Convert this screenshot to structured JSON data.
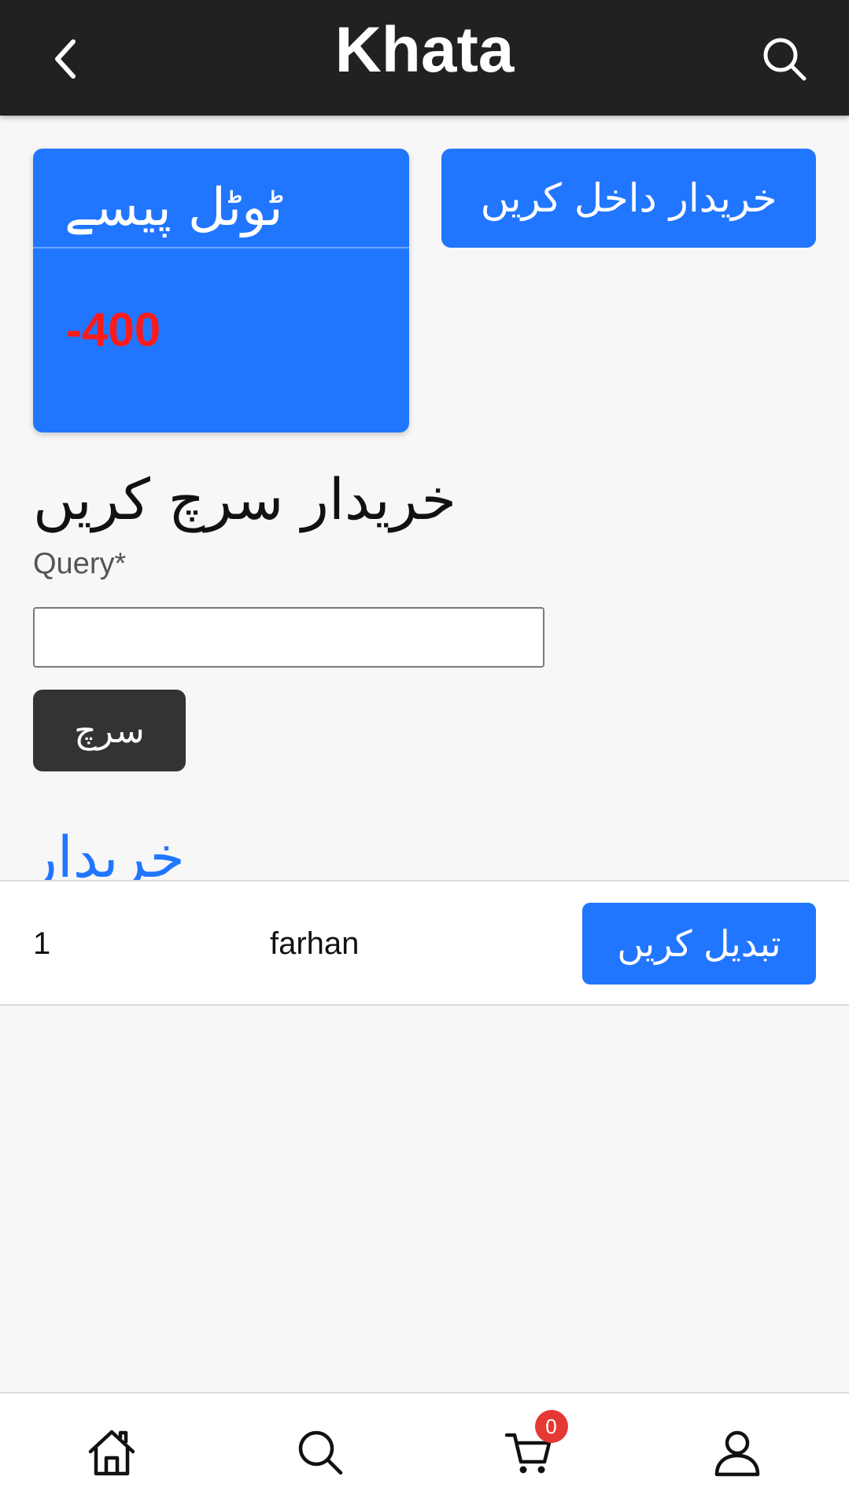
{
  "header": {
    "title": "Khata",
    "back_icon": "chevron-left-icon",
    "search_icon": "search-icon"
  },
  "total_card": {
    "title": "ٹوٹل پیسے",
    "value": "-400",
    "value_color": "#ff1a1a"
  },
  "actions": {
    "add_customer_label": "خریدار داخل کریں"
  },
  "search": {
    "heading": "خریدار سرچ کریں",
    "query_label": "Query*",
    "query_value": "",
    "button_label": "سرچ"
  },
  "customers": {
    "heading": "خریدار",
    "rows": [
      {
        "id": "1",
        "name": "farhan",
        "edit_label": "تبدیل کریں"
      }
    ]
  },
  "bottom_nav": {
    "items": [
      {
        "icon": "home-icon"
      },
      {
        "icon": "search-icon"
      },
      {
        "icon": "cart-icon",
        "badge": "0"
      },
      {
        "icon": "user-icon"
      }
    ]
  },
  "colors": {
    "header_bg": "#212121",
    "accent": "#2176ff",
    "search_button": "#333333",
    "badge": "#e53935"
  }
}
